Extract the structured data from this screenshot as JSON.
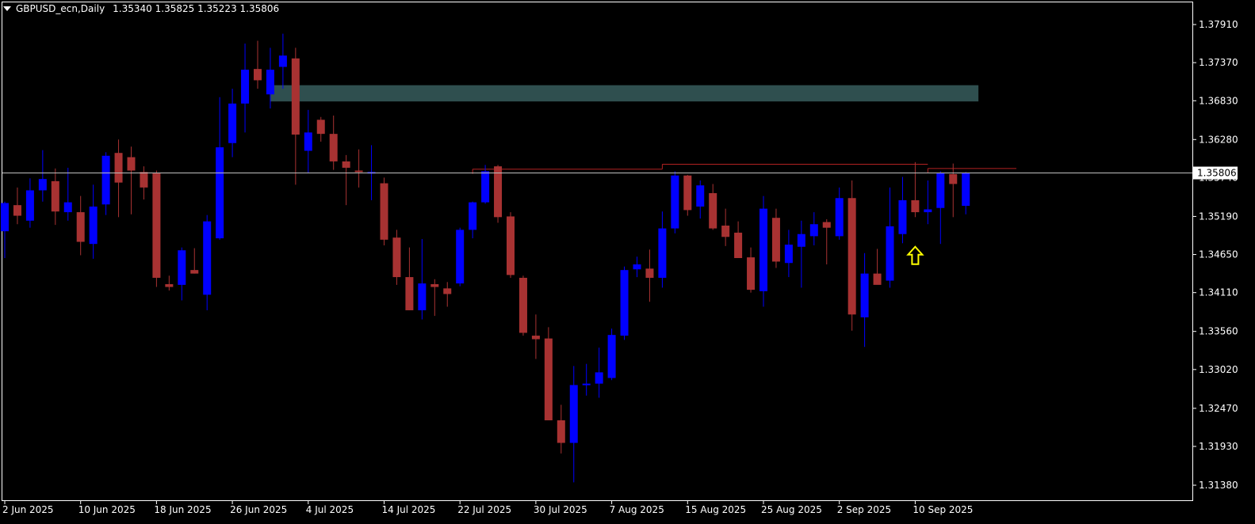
{
  "header": {
    "symbol": "GBPUSD_ecn,Daily",
    "open": "1.35340",
    "high": "1.35825",
    "low": "1.35223",
    "close": "1.35806"
  },
  "colors": {
    "background": "#000000",
    "bull": "#0000ff",
    "bear": "#a83232",
    "axis": "#ffffff",
    "zone": "#2f4f4f",
    "resistance": "#b22222",
    "price_line": "#c0c0c0",
    "arrow": "#ffff00"
  },
  "chart_data": {
    "type": "candlestick",
    "instrument": "GBPUSD_ecn",
    "timeframe": "Daily",
    "ylim": [
      1.3115,
      1.3815
    ],
    "y_ticks": [
      "1.37910",
      "1.37370",
      "1.36830",
      "1.36280",
      "1.35740",
      "1.35190",
      "1.34650",
      "1.34110",
      "1.33560",
      "1.33020",
      "1.32470",
      "1.31930",
      "1.31380"
    ],
    "y_tick_values": [
      1.3791,
      1.3737,
      1.3683,
      1.3628,
      1.3574,
      1.3519,
      1.3465,
      1.3411,
      1.3356,
      1.3302,
      1.3247,
      1.3193,
      1.3138
    ],
    "x_labels": [
      {
        "label": "2 Jun 2025",
        "index": 0
      },
      {
        "label": "10 Jun 2025",
        "index": 6
      },
      {
        "label": "18 Jun 2025",
        "index": 12
      },
      {
        "label": "26 Jun 2025",
        "index": 18
      },
      {
        "label": "4 Jul 2025",
        "index": 24
      },
      {
        "label": "14 Jul 2025",
        "index": 30
      },
      {
        "label": "22 Jul 2025",
        "index": 36
      },
      {
        "label": "30 Jul 2025",
        "index": 42
      },
      {
        "label": "7 Aug 2025",
        "index": 48
      },
      {
        "label": "15 Aug 2025",
        "index": 54
      },
      {
        "label": "25 Aug 2025",
        "index": 60
      },
      {
        "label": "2 Sep 2025",
        "index": 66
      },
      {
        "label": "10 Sep 2025",
        "index": 72
      }
    ],
    "current_price": "1.35806",
    "current_price_value": 1.35806,
    "ohlc": [
      [
        1.3498,
        1.354,
        1.346,
        1.3538
      ],
      [
        1.3535,
        1.356,
        1.3508,
        1.352
      ],
      [
        1.3513,
        1.3573,
        1.3503,
        1.3556
      ],
      [
        1.3556,
        1.3613,
        1.354,
        1.3572
      ],
      [
        1.3569,
        1.3587,
        1.3507,
        1.3526
      ],
      [
        1.3525,
        1.3588,
        1.3513,
        1.3539
      ],
      [
        1.3525,
        1.3548,
        1.3464,
        1.3483
      ],
      [
        1.348,
        1.3564,
        1.3459,
        1.3533
      ],
      [
        1.3536,
        1.361,
        1.3521,
        1.3605
      ],
      [
        1.3609,
        1.3628,
        1.3518,
        1.3567
      ],
      [
        1.3603,
        1.3618,
        1.3522,
        1.3584
      ],
      [
        1.3582,
        1.359,
        1.3543,
        1.356
      ],
      [
        1.358,
        1.3584,
        1.3419,
        1.3432
      ],
      [
        1.3423,
        1.3435,
        1.3414,
        1.3419
      ],
      [
        1.3422,
        1.3475,
        1.34,
        1.3471
      ],
      [
        1.3443,
        1.3474,
        1.3438,
        1.3438
      ],
      [
        1.3408,
        1.3521,
        1.3386,
        1.3512
      ],
      [
        1.3488,
        1.3688,
        1.3486,
        1.3617
      ],
      [
        1.3623,
        1.37,
        1.3603,
        1.3679
      ],
      [
        1.3679,
        1.3764,
        1.3638,
        1.3727
      ],
      [
        1.3728,
        1.3768,
        1.37,
        1.3712
      ],
      [
        1.3692,
        1.3758,
        1.3672,
        1.3727
      ],
      [
        1.3731,
        1.3778,
        1.37,
        1.3747
      ],
      [
        1.3743,
        1.3758,
        1.3564,
        1.3635
      ],
      [
        1.3612,
        1.367,
        1.358,
        1.3638
      ],
      [
        1.3656,
        1.366,
        1.3625,
        1.3636
      ],
      [
        1.3636,
        1.3662,
        1.3585,
        1.3597
      ],
      [
        1.3597,
        1.3606,
        1.3535,
        1.3588
      ],
      [
        1.3584,
        1.3614,
        1.356,
        1.3583
      ],
      [
        1.3582,
        1.362,
        1.3542,
        1.3582
      ],
      [
        1.3566,
        1.3574,
        1.3478,
        1.3486
      ],
      [
        1.3489,
        1.35,
        1.3422,
        1.3433
      ],
      [
        1.3433,
        1.3475,
        1.3386,
        1.3386
      ],
      [
        1.3386,
        1.3487,
        1.3373,
        1.3424
      ],
      [
        1.3423,
        1.343,
        1.3378,
        1.3419
      ],
      [
        1.3417,
        1.3426,
        1.3391,
        1.3409
      ],
      [
        1.3424,
        1.3503,
        1.342,
        1.35
      ],
      [
        1.35,
        1.354,
        1.3488,
        1.3539
      ],
      [
        1.3539,
        1.3592,
        1.3537,
        1.3583
      ],
      [
        1.359,
        1.3592,
        1.351,
        1.3518
      ],
      [
        1.3519,
        1.3525,
        1.3432,
        1.3436
      ],
      [
        1.3432,
        1.3435,
        1.335,
        1.3354
      ],
      [
        1.335,
        1.338,
        1.3317,
        1.3345
      ],
      [
        1.3346,
        1.3362,
        1.3246,
        1.323
      ],
      [
        1.323,
        1.3252,
        1.3183,
        1.3198
      ],
      [
        1.3198,
        1.3307,
        1.3142,
        1.328
      ],
      [
        1.328,
        1.331,
        1.3265,
        1.3282
      ],
      [
        1.3282,
        1.3333,
        1.3262,
        1.3298
      ],
      [
        1.329,
        1.336,
        1.3287,
        1.3351
      ],
      [
        1.335,
        1.3448,
        1.3344,
        1.3443
      ],
      [
        1.3444,
        1.3462,
        1.3433,
        1.3451
      ],
      [
        1.3445,
        1.3472,
        1.3398,
        1.3432
      ],
      [
        1.3432,
        1.3526,
        1.3418,
        1.3502
      ],
      [
        1.3502,
        1.3583,
        1.3495,
        1.3577
      ],
      [
        1.3577,
        1.3578,
        1.352,
        1.3528
      ],
      [
        1.3533,
        1.357,
        1.3516,
        1.3563
      ],
      [
        1.3552,
        1.3565,
        1.35,
        1.3502
      ],
      [
        1.3506,
        1.353,
        1.3477,
        1.349
      ],
      [
        1.3496,
        1.3512,
        1.3462,
        1.346
      ],
      [
        1.3461,
        1.3475,
        1.3411,
        1.3415
      ],
      [
        1.3413,
        1.3548,
        1.3391,
        1.353
      ],
      [
        1.3517,
        1.353,
        1.3446,
        1.3455
      ],
      [
        1.3453,
        1.35,
        1.3433,
        1.3479
      ],
      [
        1.3476,
        1.3513,
        1.3418,
        1.3494
      ],
      [
        1.3491,
        1.3525,
        1.3478,
        1.3508
      ],
      [
        1.3511,
        1.3515,
        1.3451,
        1.3503
      ],
      [
        1.3491,
        1.356,
        1.3486,
        1.3545
      ],
      [
        1.3545,
        1.357,
        1.3357,
        1.338
      ],
      [
        1.3376,
        1.3467,
        1.3334,
        1.3438
      ],
      [
        1.3438,
        1.3473,
        1.3424,
        1.3422
      ],
      [
        1.3428,
        1.356,
        1.3418,
        1.3505
      ],
      [
        1.3494,
        1.3575,
        1.3481,
        1.3542
      ],
      [
        1.3542,
        1.3596,
        1.3518,
        1.3525
      ],
      [
        1.3525,
        1.357,
        1.3508,
        1.3529
      ],
      [
        1.3531,
        1.3583,
        1.348,
        1.358
      ],
      [
        1.3579,
        1.3594,
        1.3518,
        1.3565
      ],
      [
        1.3534,
        1.3582,
        1.3522,
        1.3581
      ]
    ],
    "supply_zone": {
      "start_index": 21,
      "end_index": 77,
      "top": 1.3705,
      "bottom": 1.3682
    },
    "resistance_lines": [
      {
        "price": 1.3586,
        "start_index": 37,
        "end_index": 52
      },
      {
        "price": 1.3593,
        "start_index": 52,
        "end_index": 73
      },
      {
        "price": 1.3587,
        "start_index": 73,
        "end_index": 80
      }
    ],
    "arrow_marker": {
      "index": 72,
      "price": 1.3476,
      "direction": "up"
    }
  }
}
